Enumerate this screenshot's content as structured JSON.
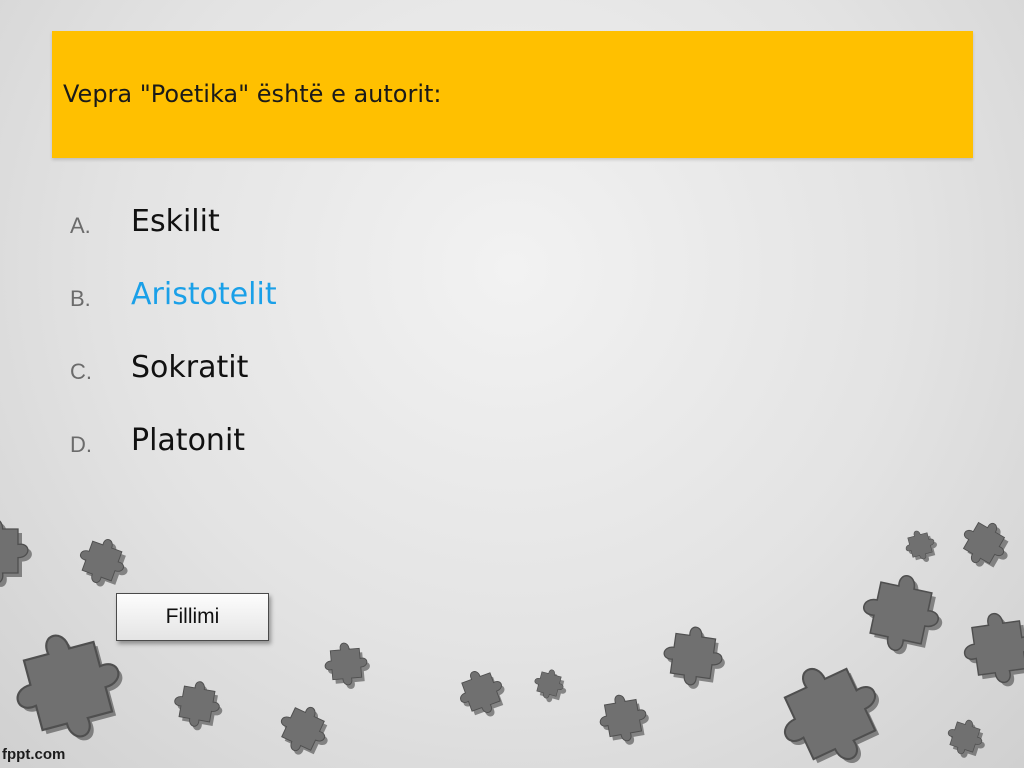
{
  "question": {
    "text": "Vepra \"Poetika\" është e autorit:"
  },
  "answers": [
    {
      "letter": "A.",
      "text": "Eskilit",
      "highlighted": false
    },
    {
      "letter": "B.",
      "text": "Aristotelit",
      "highlighted": true
    },
    {
      "letter": "C.",
      "text": "Sokratit",
      "highlighted": false
    },
    {
      "letter": "D.",
      "text": "Platonit",
      "highlighted": false
    }
  ],
  "start_button": {
    "label": "Fillimi"
  },
  "logo": {
    "text": "fppt.com"
  },
  "colors": {
    "question_bar": "#ffc000",
    "highlight": "#1aa0e8",
    "puzzle_piece": "#6f6f6f"
  },
  "decoration": {
    "icon": "puzzle-piece-icon"
  }
}
